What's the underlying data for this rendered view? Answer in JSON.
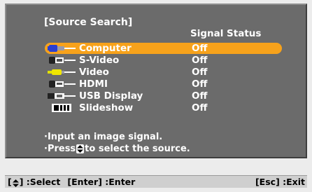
{
  "title": "[Source Search]",
  "column_header": "Signal Status",
  "sources": [
    {
      "label": "Computer",
      "status": "Off",
      "icon": "computer-port-icon",
      "selected": true
    },
    {
      "label": "S-Video",
      "status": "Off",
      "icon": "s-video-port-icon",
      "selected": false
    },
    {
      "label": "Video",
      "status": "Off",
      "icon": "video-port-icon",
      "selected": false
    },
    {
      "label": "HDMI",
      "status": "Off",
      "icon": "hdmi-port-icon",
      "selected": false
    },
    {
      "label": "USB Display",
      "status": "Off",
      "icon": "usb-display-port-icon",
      "selected": false
    },
    {
      "label": "Slideshow",
      "status": "Off",
      "icon": "slideshow-icon",
      "selected": false
    }
  ],
  "help": {
    "line1": "·Input an image signal.",
    "line2_pre": "·Press",
    "line2_post": "to select the source."
  },
  "footer": {
    "open_bracket": "[",
    "select_suffix": "] :Select",
    "enter": "[Enter] :Enter",
    "exit": "[Esc] :Exit"
  },
  "colors": {
    "panel": "#6b6b6b",
    "highlight": "#f7a21b",
    "footer": "#cfcfcf"
  }
}
